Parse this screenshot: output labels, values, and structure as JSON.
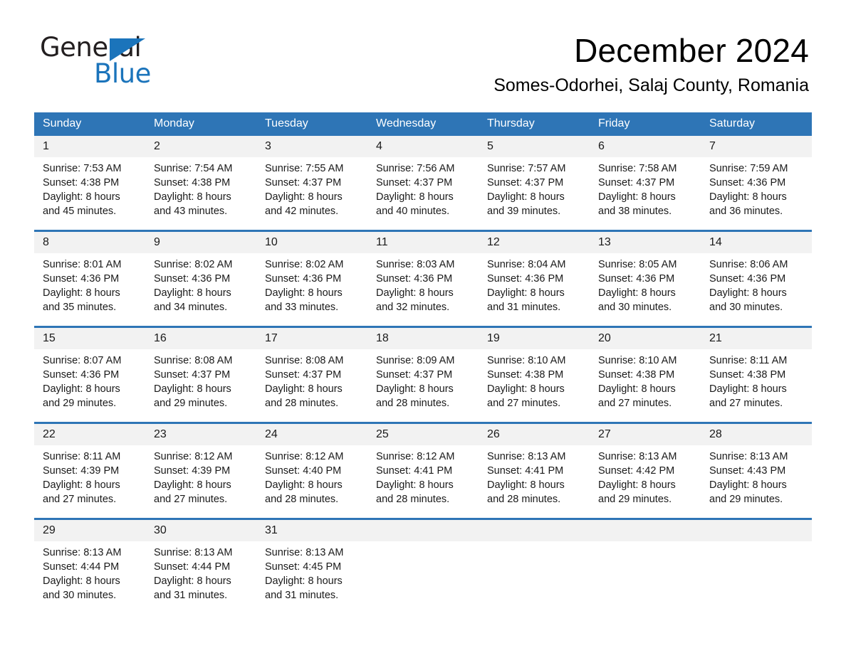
{
  "brand": {
    "logo_primary": "General",
    "logo_secondary": "Blue",
    "accent_color": "#1b74bb"
  },
  "header": {
    "month_title": "December 2024",
    "location": "Somes-Odorhei, Salaj County, Romania"
  },
  "calendar": {
    "header_color": "#2e75b6",
    "daynum_band_color": "#f2f2f2",
    "weekdays": [
      "Sunday",
      "Monday",
      "Tuesday",
      "Wednesday",
      "Thursday",
      "Friday",
      "Saturday"
    ],
    "weeks": [
      [
        {
          "day": "1",
          "sunrise": "Sunrise: 7:53 AM",
          "sunset": "Sunset: 4:38 PM",
          "daylight1": "Daylight: 8 hours",
          "daylight2": "and 45 minutes."
        },
        {
          "day": "2",
          "sunrise": "Sunrise: 7:54 AM",
          "sunset": "Sunset: 4:38 PM",
          "daylight1": "Daylight: 8 hours",
          "daylight2": "and 43 minutes."
        },
        {
          "day": "3",
          "sunrise": "Sunrise: 7:55 AM",
          "sunset": "Sunset: 4:37 PM",
          "daylight1": "Daylight: 8 hours",
          "daylight2": "and 42 minutes."
        },
        {
          "day": "4",
          "sunrise": "Sunrise: 7:56 AM",
          "sunset": "Sunset: 4:37 PM",
          "daylight1": "Daylight: 8 hours",
          "daylight2": "and 40 minutes."
        },
        {
          "day": "5",
          "sunrise": "Sunrise: 7:57 AM",
          "sunset": "Sunset: 4:37 PM",
          "daylight1": "Daylight: 8 hours",
          "daylight2": "and 39 minutes."
        },
        {
          "day": "6",
          "sunrise": "Sunrise: 7:58 AM",
          "sunset": "Sunset: 4:37 PM",
          "daylight1": "Daylight: 8 hours",
          "daylight2": "and 38 minutes."
        },
        {
          "day": "7",
          "sunrise": "Sunrise: 7:59 AM",
          "sunset": "Sunset: 4:36 PM",
          "daylight1": "Daylight: 8 hours",
          "daylight2": "and 36 minutes."
        }
      ],
      [
        {
          "day": "8",
          "sunrise": "Sunrise: 8:01 AM",
          "sunset": "Sunset: 4:36 PM",
          "daylight1": "Daylight: 8 hours",
          "daylight2": "and 35 minutes."
        },
        {
          "day": "9",
          "sunrise": "Sunrise: 8:02 AM",
          "sunset": "Sunset: 4:36 PM",
          "daylight1": "Daylight: 8 hours",
          "daylight2": "and 34 minutes."
        },
        {
          "day": "10",
          "sunrise": "Sunrise: 8:02 AM",
          "sunset": "Sunset: 4:36 PM",
          "daylight1": "Daylight: 8 hours",
          "daylight2": "and 33 minutes."
        },
        {
          "day": "11",
          "sunrise": "Sunrise: 8:03 AM",
          "sunset": "Sunset: 4:36 PM",
          "daylight1": "Daylight: 8 hours",
          "daylight2": "and 32 minutes."
        },
        {
          "day": "12",
          "sunrise": "Sunrise: 8:04 AM",
          "sunset": "Sunset: 4:36 PM",
          "daylight1": "Daylight: 8 hours",
          "daylight2": "and 31 minutes."
        },
        {
          "day": "13",
          "sunrise": "Sunrise: 8:05 AM",
          "sunset": "Sunset: 4:36 PM",
          "daylight1": "Daylight: 8 hours",
          "daylight2": "and 30 minutes."
        },
        {
          "day": "14",
          "sunrise": "Sunrise: 8:06 AM",
          "sunset": "Sunset: 4:36 PM",
          "daylight1": "Daylight: 8 hours",
          "daylight2": "and 30 minutes."
        }
      ],
      [
        {
          "day": "15",
          "sunrise": "Sunrise: 8:07 AM",
          "sunset": "Sunset: 4:36 PM",
          "daylight1": "Daylight: 8 hours",
          "daylight2": "and 29 minutes."
        },
        {
          "day": "16",
          "sunrise": "Sunrise: 8:08 AM",
          "sunset": "Sunset: 4:37 PM",
          "daylight1": "Daylight: 8 hours",
          "daylight2": "and 29 minutes."
        },
        {
          "day": "17",
          "sunrise": "Sunrise: 8:08 AM",
          "sunset": "Sunset: 4:37 PM",
          "daylight1": "Daylight: 8 hours",
          "daylight2": "and 28 minutes."
        },
        {
          "day": "18",
          "sunrise": "Sunrise: 8:09 AM",
          "sunset": "Sunset: 4:37 PM",
          "daylight1": "Daylight: 8 hours",
          "daylight2": "and 28 minutes."
        },
        {
          "day": "19",
          "sunrise": "Sunrise: 8:10 AM",
          "sunset": "Sunset: 4:38 PM",
          "daylight1": "Daylight: 8 hours",
          "daylight2": "and 27 minutes."
        },
        {
          "day": "20",
          "sunrise": "Sunrise: 8:10 AM",
          "sunset": "Sunset: 4:38 PM",
          "daylight1": "Daylight: 8 hours",
          "daylight2": "and 27 minutes."
        },
        {
          "day": "21",
          "sunrise": "Sunrise: 8:11 AM",
          "sunset": "Sunset: 4:38 PM",
          "daylight1": "Daylight: 8 hours",
          "daylight2": "and 27 minutes."
        }
      ],
      [
        {
          "day": "22",
          "sunrise": "Sunrise: 8:11 AM",
          "sunset": "Sunset: 4:39 PM",
          "daylight1": "Daylight: 8 hours",
          "daylight2": "and 27 minutes."
        },
        {
          "day": "23",
          "sunrise": "Sunrise: 8:12 AM",
          "sunset": "Sunset: 4:39 PM",
          "daylight1": "Daylight: 8 hours",
          "daylight2": "and 27 minutes."
        },
        {
          "day": "24",
          "sunrise": "Sunrise: 8:12 AM",
          "sunset": "Sunset: 4:40 PM",
          "daylight1": "Daylight: 8 hours",
          "daylight2": "and 28 minutes."
        },
        {
          "day": "25",
          "sunrise": "Sunrise: 8:12 AM",
          "sunset": "Sunset: 4:41 PM",
          "daylight1": "Daylight: 8 hours",
          "daylight2": "and 28 minutes."
        },
        {
          "day": "26",
          "sunrise": "Sunrise: 8:13 AM",
          "sunset": "Sunset: 4:41 PM",
          "daylight1": "Daylight: 8 hours",
          "daylight2": "and 28 minutes."
        },
        {
          "day": "27",
          "sunrise": "Sunrise: 8:13 AM",
          "sunset": "Sunset: 4:42 PM",
          "daylight1": "Daylight: 8 hours",
          "daylight2": "and 29 minutes."
        },
        {
          "day": "28",
          "sunrise": "Sunrise: 8:13 AM",
          "sunset": "Sunset: 4:43 PM",
          "daylight1": "Daylight: 8 hours",
          "daylight2": "and 29 minutes."
        }
      ],
      [
        {
          "day": "29",
          "sunrise": "Sunrise: 8:13 AM",
          "sunset": "Sunset: 4:44 PM",
          "daylight1": "Daylight: 8 hours",
          "daylight2": "and 30 minutes."
        },
        {
          "day": "30",
          "sunrise": "Sunrise: 8:13 AM",
          "sunset": "Sunset: 4:44 PM",
          "daylight1": "Daylight: 8 hours",
          "daylight2": "and 31 minutes."
        },
        {
          "day": "31",
          "sunrise": "Sunrise: 8:13 AM",
          "sunset": "Sunset: 4:45 PM",
          "daylight1": "Daylight: 8 hours",
          "daylight2": "and 31 minutes."
        },
        {
          "day": "",
          "sunrise": "",
          "sunset": "",
          "daylight1": "",
          "daylight2": ""
        },
        {
          "day": "",
          "sunrise": "",
          "sunset": "",
          "daylight1": "",
          "daylight2": ""
        },
        {
          "day": "",
          "sunrise": "",
          "sunset": "",
          "daylight1": "",
          "daylight2": ""
        },
        {
          "day": "",
          "sunrise": "",
          "sunset": "",
          "daylight1": "",
          "daylight2": ""
        }
      ]
    ]
  }
}
